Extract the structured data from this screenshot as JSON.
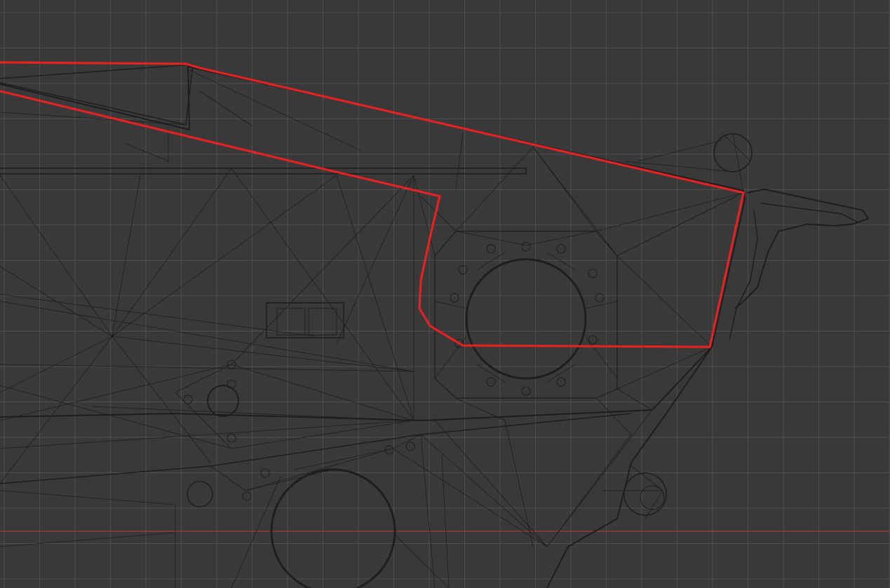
{
  "viewport": {
    "background": "#393939",
    "grid_color": "#4f4f4f",
    "x_axis_color": "#a33a3a",
    "mesh_color": "#1e1e1e",
    "selection_color": "#e32222"
  }
}
